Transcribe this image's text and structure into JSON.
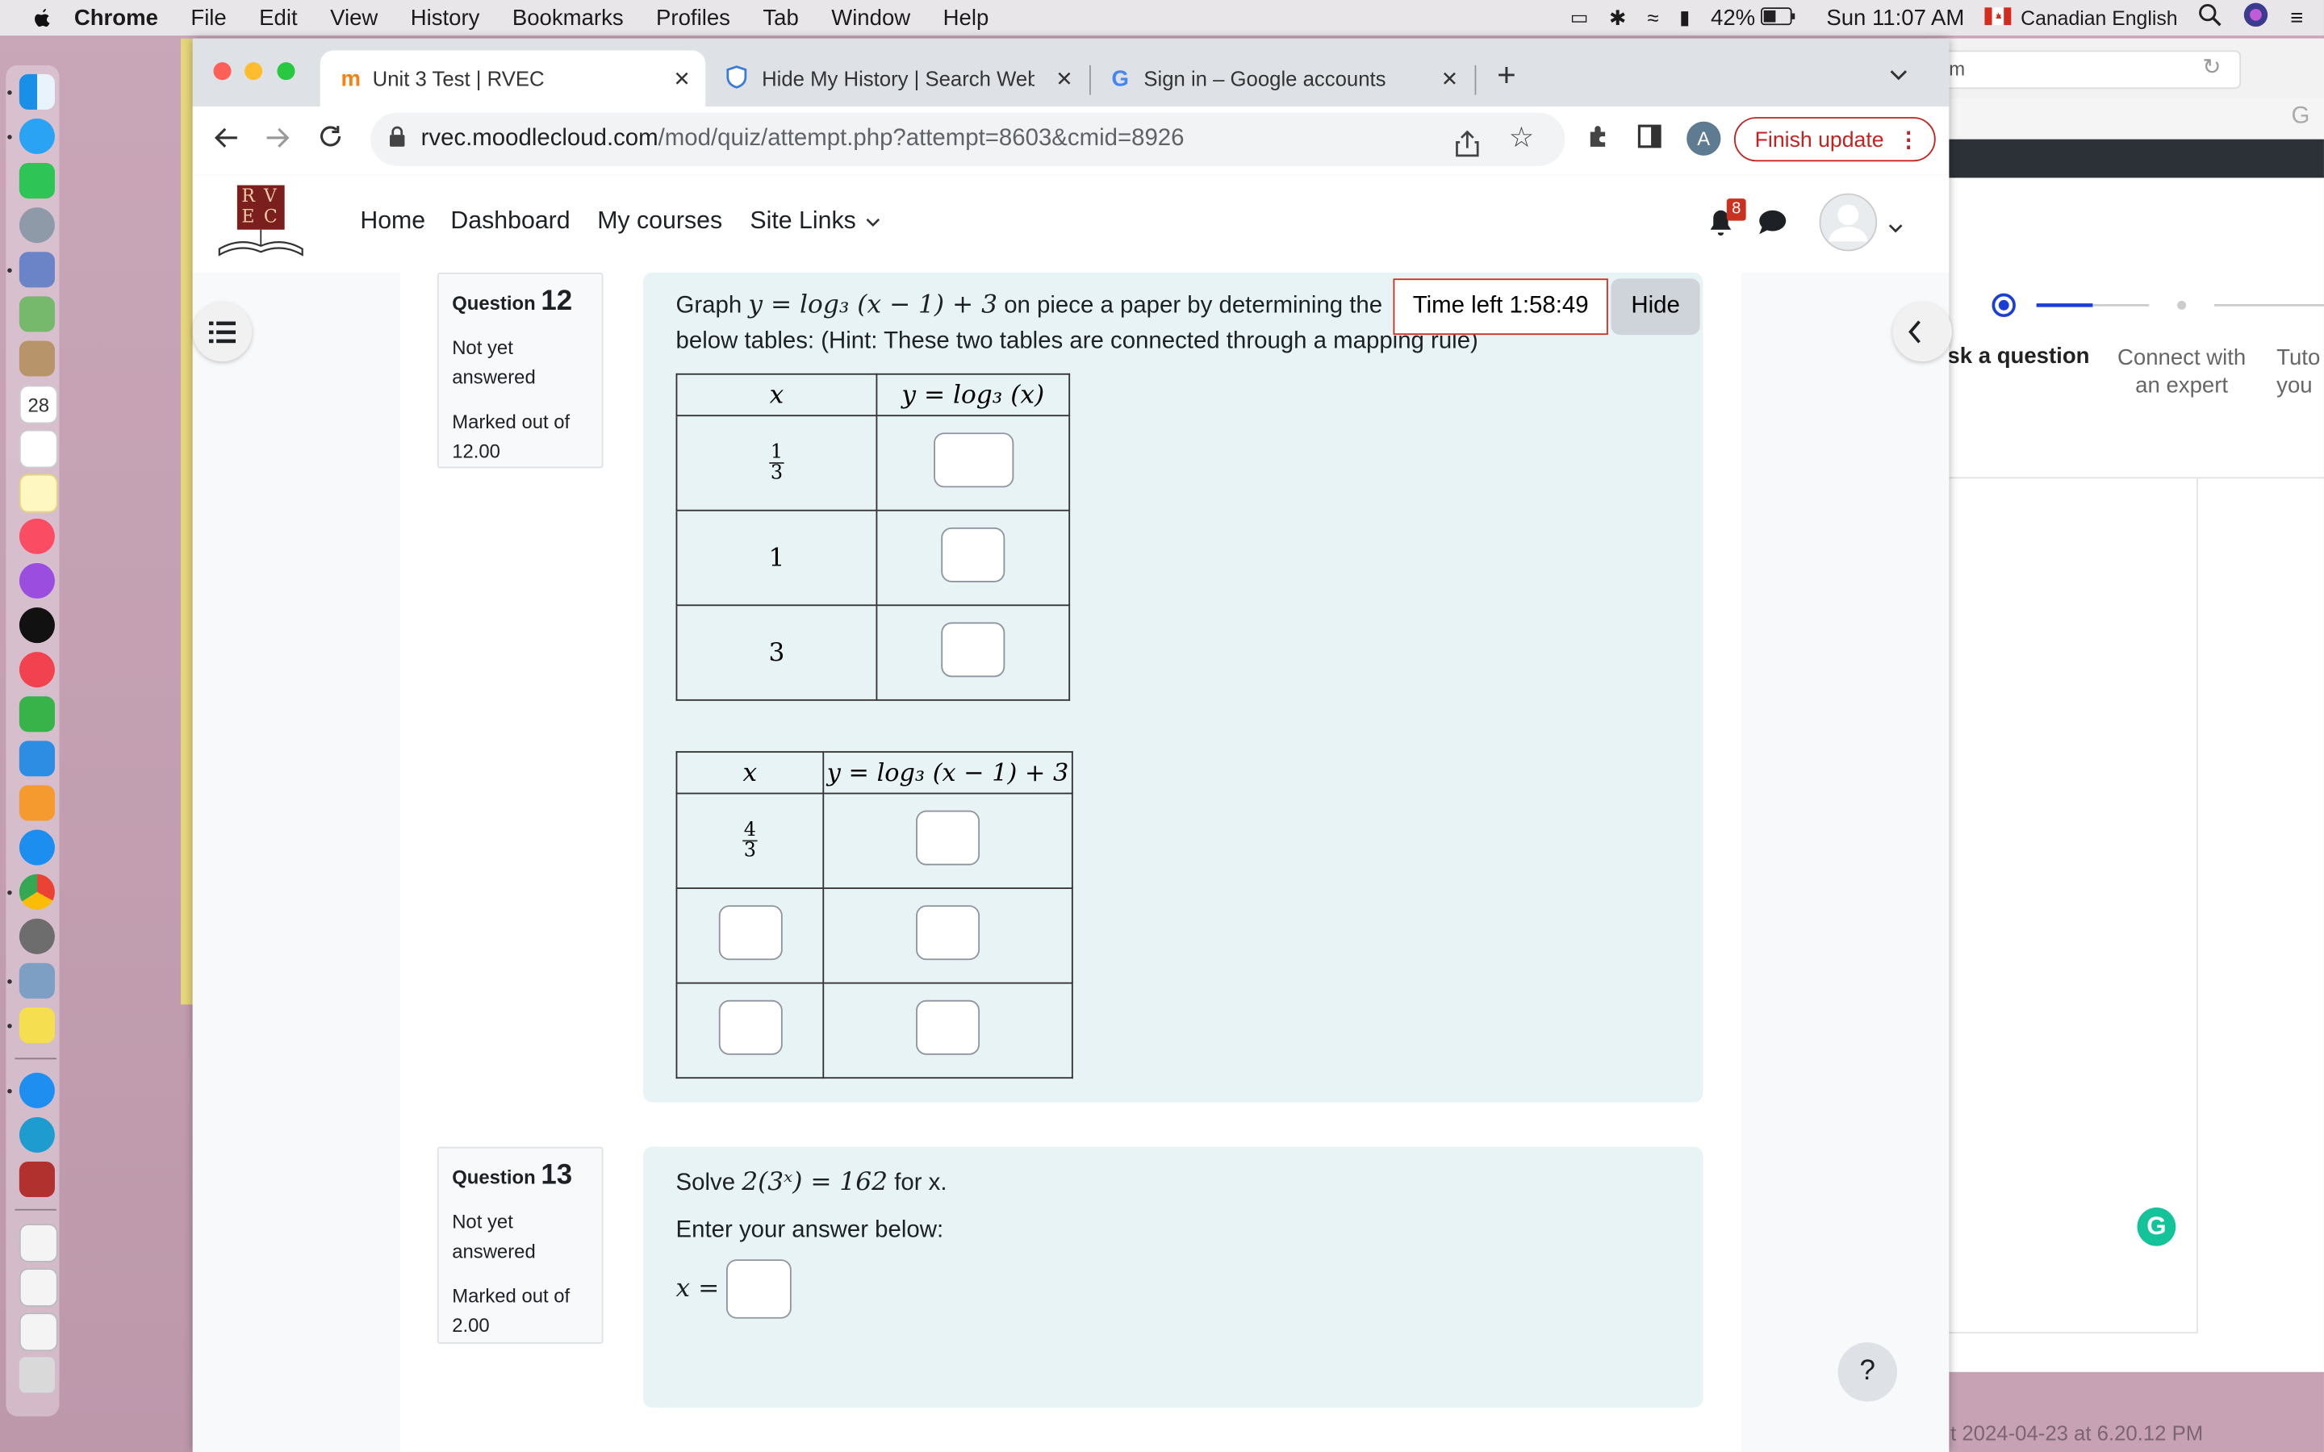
{
  "menubar": {
    "app": "Chrome",
    "items": [
      "File",
      "Edit",
      "View",
      "History",
      "Bookmarks",
      "Profiles",
      "Tab",
      "Window",
      "Help"
    ],
    "battery": "42%",
    "clock": "Sun 11:07 AM",
    "input_source": "Canadian English"
  },
  "tabs": [
    {
      "title": "Unit 3 Test | RVEC"
    },
    {
      "title": "Hide My History | Search Web"
    },
    {
      "title": "Sign in – Google accounts"
    }
  ],
  "omnibox": {
    "host": "rvec.moodlecloud.com",
    "path": "/mod/quiz/attempt.php?attempt=8603&cmid=8926"
  },
  "profile_letter": "A",
  "finish_update": "Finish update",
  "moodle": {
    "logo_letters": [
      "R",
      "V",
      "E",
      "C"
    ],
    "nav": [
      "Home",
      "Dashboard",
      "My courses",
      "Site Links"
    ],
    "notification_count": "8"
  },
  "timer": {
    "label": "Time left 1:58:49",
    "hide": "Hide"
  },
  "q12": {
    "label": "Question",
    "number": "12",
    "status": "Not yet answered",
    "marks": "Marked out of 12.00",
    "prompt_pre": "Graph",
    "equation": "y = log₃ (x − 1) + 3",
    "prompt_post": "on piece a paper by determining the",
    "prompt_line2": "below tables: (Hint: These two tables are connected through a mapping rule)",
    "table1": {
      "headers": [
        "x",
        "y = log₃ (x)"
      ],
      "x_values": [
        "1/3",
        "1",
        "3"
      ]
    },
    "table2": {
      "headers": [
        "x",
        "y = log₃ (x − 1) + 3"
      ],
      "first_x": "4/3"
    }
  },
  "q13": {
    "label": "Question",
    "number": "13",
    "status": "Not yet answered",
    "marks": "Marked out of 2.00",
    "solve_pre": "Solve",
    "equation": "2(3ˣ) = 162",
    "solve_post": "for x.",
    "instruction": "Enter your answer below:",
    "answer_label": "x ="
  },
  "bg_window": {
    "addr": "m",
    "steps": [
      "sk a question",
      "Connect with an expert",
      "Tuto you"
    ],
    "footer": "t 2024-04-23 at 6.20.12 PM"
  },
  "help_glyph": "?"
}
